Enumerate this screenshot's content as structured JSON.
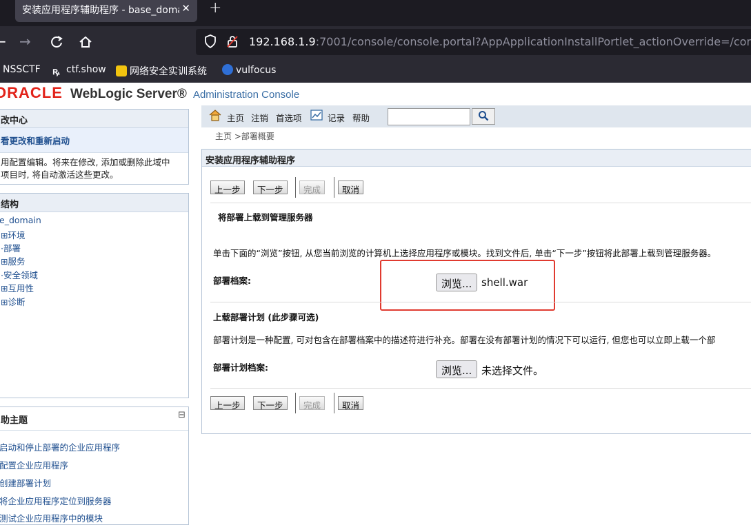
{
  "browser": {
    "tab_title": "安装应用程序辅助程序 - base_domain",
    "tab_close": "✕",
    "new_tab": "+",
    "url_host": "192.168.1.9",
    "url_rest": ":7001/console/console.portal?AppApplicationInstallPortlet_actionOverride=/com",
    "bookmarks": [
      "NSSCTF",
      "ctf.show",
      "网络安全实训系统",
      "vulfocus"
    ]
  },
  "brand": {
    "oracle": "ORACLE",
    "product": "WebLogic Server®",
    "console": "Administration Console"
  },
  "change_center": {
    "title": "改中心",
    "link": "看更改和重新启动",
    "text_line1": "用配置编辑。将来在修改, 添加或删除此域中",
    "text_line2": "项目时, 将自动激活这些更改。"
  },
  "domain_structure": {
    "title": "结构",
    "items": [
      "e_domain",
      "环境",
      "部署",
      "服务",
      "安全领域",
      "互用性",
      "诊断"
    ]
  },
  "help_topics": {
    "title": "助主题",
    "collapse": "⊟",
    "items": [
      "启动和停止部署的企业应用程序",
      "配置企业应用程序",
      "创建部署计划",
      "将企业应用程序定位到服务器",
      "测试企业应用程序中的模块"
    ]
  },
  "toolbar": {
    "home": "主页",
    "logout": "注销",
    "preferences": "首选项",
    "record": "记录",
    "help": "帮助",
    "search_value": ""
  },
  "breadcrumb": "主页 >部署概要",
  "assistant": {
    "title": "安装应用程序辅助程序",
    "buttons": {
      "back": "上一步",
      "next": "下一步",
      "finish": "完成",
      "cancel": "取消"
    },
    "section_title": "将部署上载到管理服务器",
    "instructions": "单击下面的“浏览”按钮, 从您当前浏览的计算机上选择应用程序或模块。找到文件后, 单击“下一步”按钮将此部署上载到管理服务器。",
    "archive_label": "部署档案:",
    "browse_label": "浏览...",
    "archive_file": "shell.war",
    "plan_section_title": "上载部署计划 (此步骤可选)",
    "plan_instructions": "部署计划是一种配置, 可对包含在部署档案中的描述符进行补充。部署在没有部署计划的情况下可以运行, 但您也可以立即上载一个部",
    "plan_label": "部署计划档案:",
    "plan_file": "未选择文件。"
  },
  "colors": {
    "highlight": "#e03a2f",
    "oracle_red": "#e2231a",
    "link": "#1f4f8f"
  }
}
